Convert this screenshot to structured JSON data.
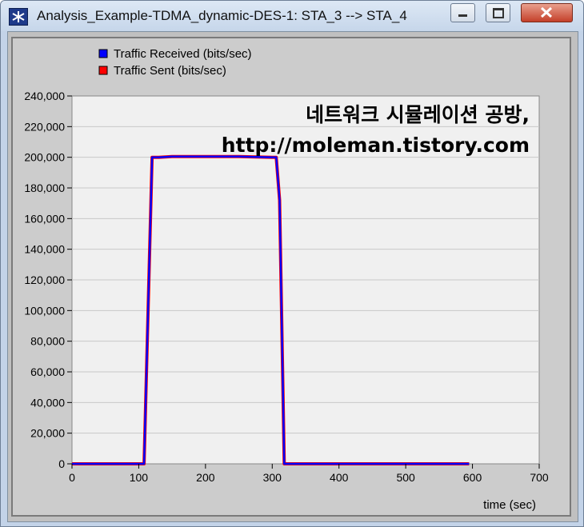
{
  "window": {
    "title": "Analysis_Example-TDMA_dynamic-DES-1: STA_3 --> STA_4",
    "icon": "asterisk-star-icon",
    "buttons": [
      "minimize-icon",
      "maximize-icon",
      "close-icon"
    ]
  },
  "watermark": {
    "line1": "네트워크 시뮬레이션 공방,",
    "line2": "http://moleman.tistory.com"
  },
  "chart_data": {
    "type": "line",
    "xlabel": "time (sec)",
    "ylabel": "",
    "xlim": [
      0,
      700
    ],
    "ylim": [
      0,
      240000
    ],
    "x_ticks": [
      0,
      100,
      200,
      300,
      400,
      500,
      600,
      700
    ],
    "y_ticks": [
      0,
      20000,
      40000,
      60000,
      80000,
      100000,
      120000,
      140000,
      160000,
      180000,
      200000,
      220000,
      240000
    ],
    "x_tick_labels": [
      "0",
      "100",
      "200",
      "300",
      "400",
      "500",
      "600",
      "700"
    ],
    "y_tick_labels": [
      "0",
      "20,000",
      "40,000",
      "60,000",
      "80,000",
      "100,000",
      "120,000",
      "140,000",
      "160,000",
      "180,000",
      "200,000",
      "220,000",
      "240,000"
    ],
    "grid": "horizontal",
    "legend_position": "top-left",
    "background": "#f0f0f0",
    "series": [
      {
        "name": "Traffic Sent (bits/sec)",
        "color": "#ff0000",
        "x": [
          0,
          108,
          120,
          130,
          150,
          200,
          250,
          300,
          306,
          311,
          318,
          330,
          400,
          500,
          595
        ],
        "y": [
          0,
          0,
          200000,
          200000,
          200500,
          200500,
          200500,
          200000,
          200000,
          172000,
          0,
          0,
          0,
          0,
          0
        ]
      },
      {
        "name": "Traffic Received (bits/sec)",
        "color": "#0000ff",
        "x": [
          0,
          108,
          120,
          130,
          150,
          200,
          250,
          300,
          306,
          311,
          318,
          330,
          400,
          500,
          595
        ],
        "y": [
          0,
          0,
          200000,
          200000,
          200500,
          200500,
          200500,
          200000,
          200000,
          172000,
          0,
          0,
          0,
          0,
          0
        ]
      }
    ],
    "legend": [
      {
        "name": "Traffic Received (bits/sec)",
        "color": "#0000ff"
      },
      {
        "name": "Traffic Sent (bits/sec)",
        "color": "#ff0000"
      }
    ]
  }
}
